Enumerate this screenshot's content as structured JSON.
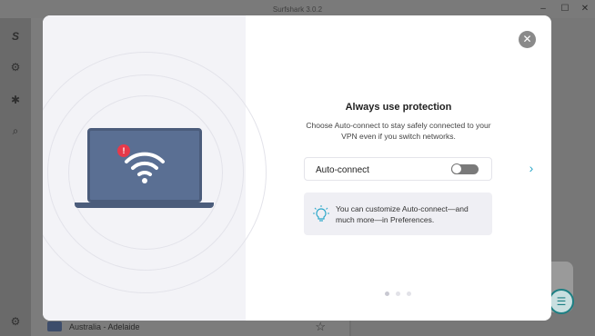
{
  "app": {
    "window_title": "Surfshark 3.0.2"
  },
  "window_controls": {
    "minimize": "–",
    "maximize": "☐",
    "close": "✕"
  },
  "background": {
    "server_name": "Australia - Adelaide"
  },
  "modal": {
    "heading": "Always use protection",
    "subtext": "Choose Auto-connect to stay safely connected to your VPN even if you switch networks.",
    "auto_connect_label": "Auto-connect",
    "auto_connect_enabled": false,
    "info_text": "You can customize Auto-connect—and much more—in Preferences.",
    "close_glyph": "✕",
    "next_glyph": "›",
    "alert_glyph": "!",
    "pager": {
      "total": 3,
      "active": 0
    }
  },
  "colors": {
    "accent": "#2aa7c9",
    "laptop": "#5a6f93",
    "alert": "#e6394a",
    "chat": "#1d7f83"
  },
  "icons": [
    "surfshark-logo-icon",
    "settings-icon",
    "bug-icon",
    "search-icon",
    "gear-icon",
    "star-icon",
    "chat-icon",
    "close-icon",
    "wifi-icon",
    "lightbulb-icon",
    "chevron-right-icon"
  ]
}
